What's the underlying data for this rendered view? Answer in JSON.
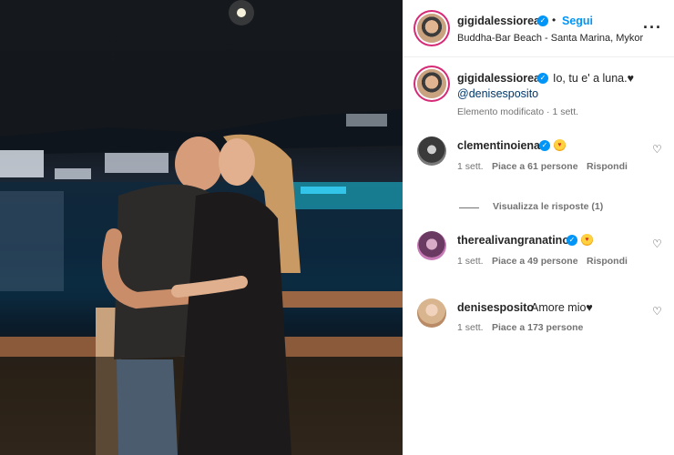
{
  "post": {
    "author": "gigidalessioreal",
    "follow_label": "Segui",
    "separator": "•",
    "location": "Buddha-Bar Beach - Santa Marina, Mykor",
    "caption_text": "Io, tu e' a luna.♥",
    "caption_mention": "@denisesposito",
    "caption_meta": "Elemento modificato · 1 sett."
  },
  "comments": [
    {
      "user": "clementinoiena",
      "text": "😍",
      "time": "1 sett.",
      "likes": "Piace a 61 persone",
      "reply": "Rispondi",
      "emoji": "heart-eyes-emoji"
    },
    {
      "user": "therealivangranatino",
      "text": "😍",
      "time": "1 sett.",
      "likes": "Piace a 49 persone",
      "reply": "Rispondi",
      "emoji": "heart-eyes-emoji"
    },
    {
      "user": "denisesposito",
      "text": "Amore mio♥",
      "time": "1 sett.",
      "likes": "Piace a 173 persone",
      "reply": ""
    }
  ],
  "view_replies": "Visualizza le risposte (1)",
  "icons": {
    "verified": "verified-badge-icon",
    "more": "more-options-icon",
    "like": "heart-outline-icon"
  },
  "colors": {
    "accent": "#0095f6",
    "mention": "#00376b",
    "muted": "#737373",
    "story_ring": "#d62976"
  }
}
